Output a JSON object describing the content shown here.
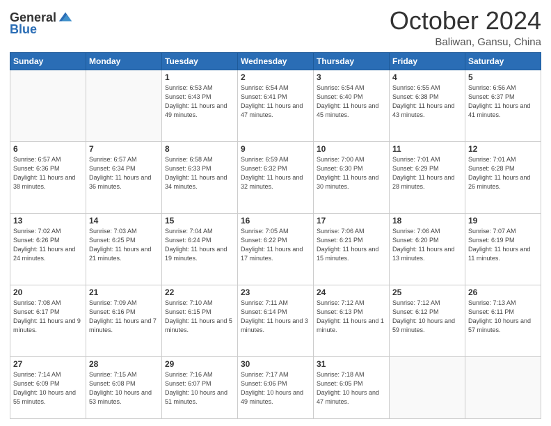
{
  "header": {
    "logo_general": "General",
    "logo_blue": "Blue",
    "month": "October 2024",
    "location": "Baliwan, Gansu, China"
  },
  "weekdays": [
    "Sunday",
    "Monday",
    "Tuesday",
    "Wednesday",
    "Thursday",
    "Friday",
    "Saturday"
  ],
  "weeks": [
    [
      {
        "day": "",
        "info": ""
      },
      {
        "day": "",
        "info": ""
      },
      {
        "day": "1",
        "info": "Sunrise: 6:53 AM\nSunset: 6:43 PM\nDaylight: 11 hours and 49 minutes."
      },
      {
        "day": "2",
        "info": "Sunrise: 6:54 AM\nSunset: 6:41 PM\nDaylight: 11 hours and 47 minutes."
      },
      {
        "day": "3",
        "info": "Sunrise: 6:54 AM\nSunset: 6:40 PM\nDaylight: 11 hours and 45 minutes."
      },
      {
        "day": "4",
        "info": "Sunrise: 6:55 AM\nSunset: 6:38 PM\nDaylight: 11 hours and 43 minutes."
      },
      {
        "day": "5",
        "info": "Sunrise: 6:56 AM\nSunset: 6:37 PM\nDaylight: 11 hours and 41 minutes."
      }
    ],
    [
      {
        "day": "6",
        "info": "Sunrise: 6:57 AM\nSunset: 6:36 PM\nDaylight: 11 hours and 38 minutes."
      },
      {
        "day": "7",
        "info": "Sunrise: 6:57 AM\nSunset: 6:34 PM\nDaylight: 11 hours and 36 minutes."
      },
      {
        "day": "8",
        "info": "Sunrise: 6:58 AM\nSunset: 6:33 PM\nDaylight: 11 hours and 34 minutes."
      },
      {
        "day": "9",
        "info": "Sunrise: 6:59 AM\nSunset: 6:32 PM\nDaylight: 11 hours and 32 minutes."
      },
      {
        "day": "10",
        "info": "Sunrise: 7:00 AM\nSunset: 6:30 PM\nDaylight: 11 hours and 30 minutes."
      },
      {
        "day": "11",
        "info": "Sunrise: 7:01 AM\nSunset: 6:29 PM\nDaylight: 11 hours and 28 minutes."
      },
      {
        "day": "12",
        "info": "Sunrise: 7:01 AM\nSunset: 6:28 PM\nDaylight: 11 hours and 26 minutes."
      }
    ],
    [
      {
        "day": "13",
        "info": "Sunrise: 7:02 AM\nSunset: 6:26 PM\nDaylight: 11 hours and 24 minutes."
      },
      {
        "day": "14",
        "info": "Sunrise: 7:03 AM\nSunset: 6:25 PM\nDaylight: 11 hours and 21 minutes."
      },
      {
        "day": "15",
        "info": "Sunrise: 7:04 AM\nSunset: 6:24 PM\nDaylight: 11 hours and 19 minutes."
      },
      {
        "day": "16",
        "info": "Sunrise: 7:05 AM\nSunset: 6:22 PM\nDaylight: 11 hours and 17 minutes."
      },
      {
        "day": "17",
        "info": "Sunrise: 7:06 AM\nSunset: 6:21 PM\nDaylight: 11 hours and 15 minutes."
      },
      {
        "day": "18",
        "info": "Sunrise: 7:06 AM\nSunset: 6:20 PM\nDaylight: 11 hours and 13 minutes."
      },
      {
        "day": "19",
        "info": "Sunrise: 7:07 AM\nSunset: 6:19 PM\nDaylight: 11 hours and 11 minutes."
      }
    ],
    [
      {
        "day": "20",
        "info": "Sunrise: 7:08 AM\nSunset: 6:17 PM\nDaylight: 11 hours and 9 minutes."
      },
      {
        "day": "21",
        "info": "Sunrise: 7:09 AM\nSunset: 6:16 PM\nDaylight: 11 hours and 7 minutes."
      },
      {
        "day": "22",
        "info": "Sunrise: 7:10 AM\nSunset: 6:15 PM\nDaylight: 11 hours and 5 minutes."
      },
      {
        "day": "23",
        "info": "Sunrise: 7:11 AM\nSunset: 6:14 PM\nDaylight: 11 hours and 3 minutes."
      },
      {
        "day": "24",
        "info": "Sunrise: 7:12 AM\nSunset: 6:13 PM\nDaylight: 11 hours and 1 minute."
      },
      {
        "day": "25",
        "info": "Sunrise: 7:12 AM\nSunset: 6:12 PM\nDaylight: 10 hours and 59 minutes."
      },
      {
        "day": "26",
        "info": "Sunrise: 7:13 AM\nSunset: 6:11 PM\nDaylight: 10 hours and 57 minutes."
      }
    ],
    [
      {
        "day": "27",
        "info": "Sunrise: 7:14 AM\nSunset: 6:09 PM\nDaylight: 10 hours and 55 minutes."
      },
      {
        "day": "28",
        "info": "Sunrise: 7:15 AM\nSunset: 6:08 PM\nDaylight: 10 hours and 53 minutes."
      },
      {
        "day": "29",
        "info": "Sunrise: 7:16 AM\nSunset: 6:07 PM\nDaylight: 10 hours and 51 minutes."
      },
      {
        "day": "30",
        "info": "Sunrise: 7:17 AM\nSunset: 6:06 PM\nDaylight: 10 hours and 49 minutes."
      },
      {
        "day": "31",
        "info": "Sunrise: 7:18 AM\nSunset: 6:05 PM\nDaylight: 10 hours and 47 minutes."
      },
      {
        "day": "",
        "info": ""
      },
      {
        "day": "",
        "info": ""
      }
    ]
  ]
}
